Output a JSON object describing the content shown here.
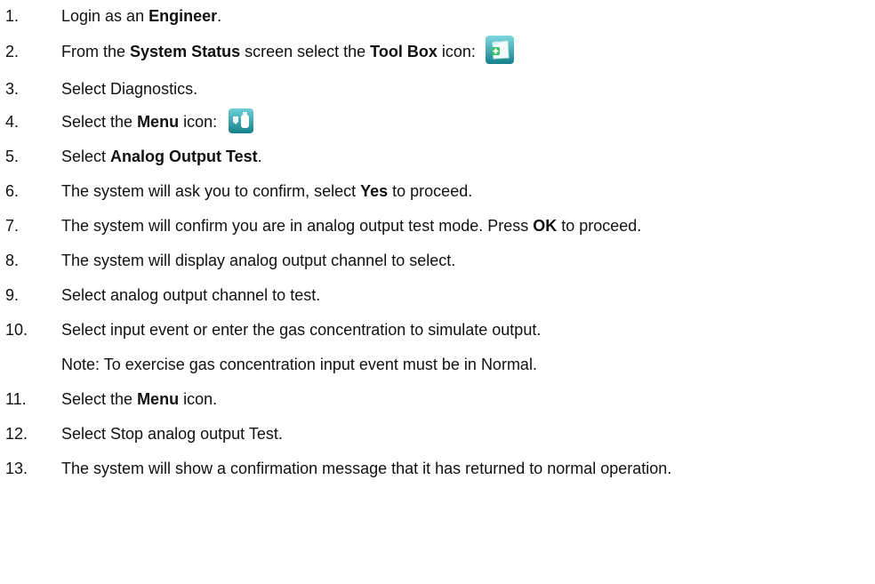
{
  "steps": [
    {
      "num": "1.",
      "parts": [
        {
          "t": "Login as an "
        },
        {
          "t": "Engineer",
          "b": true
        },
        {
          "t": "."
        }
      ]
    },
    {
      "num": "2.",
      "parts": [
        {
          "t": "From the "
        },
        {
          "t": "System Status",
          "b": true
        },
        {
          "t": " screen select the "
        },
        {
          "t": "Tool Box",
          "b": true
        },
        {
          "t": " icon:"
        }
      ],
      "icon": "toolbox-icon"
    },
    {
      "num": "3.",
      "parts": [
        {
          "t": "Select Diagnostics."
        }
      ]
    },
    {
      "num": "4.",
      "parts": [
        {
          "t": "Select the "
        },
        {
          "t": "Menu",
          "b": true
        },
        {
          "t": " icon:"
        }
      ],
      "icon": "menu-icon"
    },
    {
      "num": "5.",
      "parts": [
        {
          "t": "Select "
        },
        {
          "t": "Analog Output Test",
          "b": true
        },
        {
          "t": "."
        }
      ]
    },
    {
      "num": "6.",
      "parts": [
        {
          "t": "The system will ask you to confirm, select "
        },
        {
          "t": "Yes",
          "b": true
        },
        {
          "t": " to proceed."
        }
      ]
    },
    {
      "num": "7.",
      "parts": [
        {
          "t": "The system will confirm you are in analog output test mode. Press "
        },
        {
          "t": "OK",
          "b": true
        },
        {
          "t": " to proceed."
        }
      ]
    },
    {
      "num": "8.",
      "parts": [
        {
          "t": "The system will display analog output channel to select."
        }
      ]
    },
    {
      "num": "9.",
      "parts": [
        {
          "t": "Select analog output channel to test."
        }
      ]
    },
    {
      "num": "10.",
      "parts": [
        {
          "t": "Select input event or enter the gas concentration to simulate output."
        }
      ]
    },
    {
      "num": "",
      "parts": [
        {
          "t": "Note: To exercise gas concentration input event must be in Normal."
        }
      ]
    },
    {
      "num": "11.",
      "parts": [
        {
          "t": "Select the "
        },
        {
          "t": "Menu",
          "b": true
        },
        {
          "t": " icon."
        }
      ]
    },
    {
      "num": "12.",
      "parts": [
        {
          "t": "Select Stop analog output Test."
        }
      ]
    },
    {
      "num": "13.",
      "parts": [
        {
          "t": "The system will show a confirmation message that it has returned to normal operation."
        }
      ]
    }
  ],
  "colors": {
    "icon_teal": "#2aa7b3",
    "icon_teal_dark": "#15808c",
    "icon_green": "#3bbf6a"
  }
}
